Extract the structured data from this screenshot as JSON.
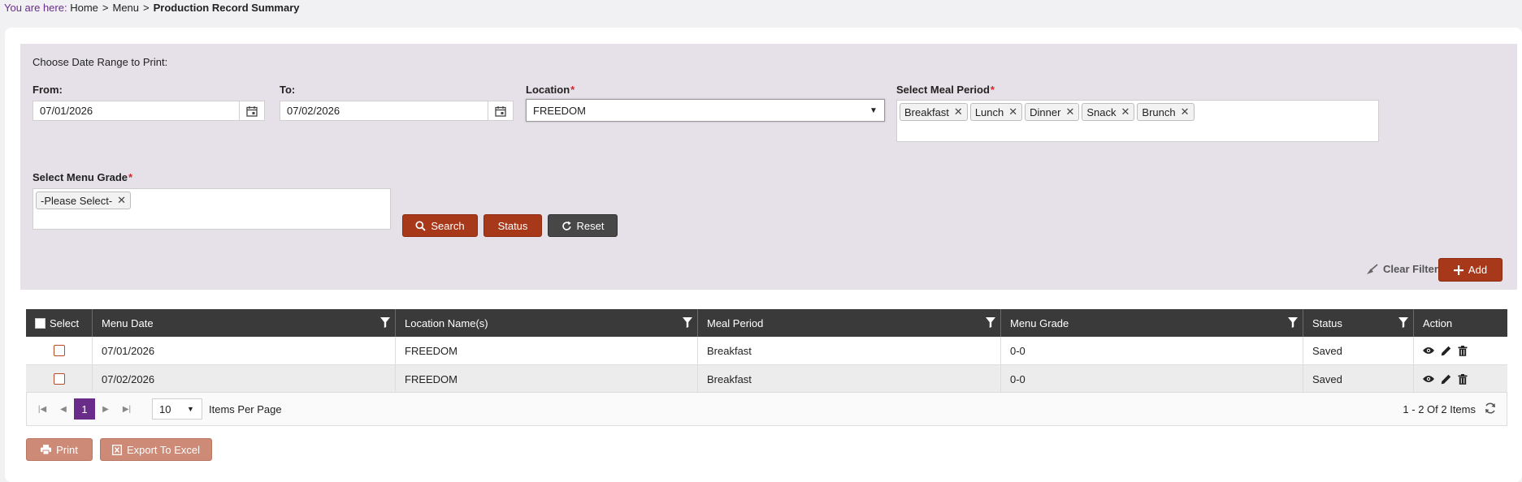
{
  "breadcrumb": {
    "prefix": "You are here:",
    "home": "Home",
    "menu": "Menu",
    "current": "Production Record Summary",
    "separator": ">"
  },
  "filters": {
    "heading": "Choose Date Range to Print:",
    "from": {
      "label": "From:",
      "value": "07/01/2026"
    },
    "to": {
      "label": "To:",
      "value": "07/02/2026"
    },
    "location": {
      "label": "Location",
      "required": "*",
      "value": "FREEDOM"
    },
    "meal_period": {
      "label": "Select Meal Period",
      "required": "*",
      "chips": [
        "Breakfast",
        "Lunch",
        "Dinner",
        "Snack",
        "Brunch"
      ]
    },
    "menu_grade": {
      "label": "Select Menu Grade",
      "required": "*",
      "chips": [
        "-Please Select-"
      ]
    },
    "buttons": {
      "search": "Search",
      "status": "Status",
      "reset": "Reset"
    },
    "clear_filter": "Clear Filter",
    "add": "Add"
  },
  "grid": {
    "columns": {
      "select": "Select",
      "menu_date": "Menu Date",
      "location": "Location Name(s)",
      "meal_period": "Meal Period",
      "menu_grade": "Menu Grade",
      "status": "Status",
      "action": "Action"
    },
    "rows": [
      {
        "menu_date": "07/01/2026",
        "location": "FREEDOM",
        "meal_period": "Breakfast",
        "menu_grade": "0-0",
        "status": "Saved"
      },
      {
        "menu_date": "07/02/2026",
        "location": "FREEDOM",
        "meal_period": "Breakfast",
        "menu_grade": "0-0",
        "status": "Saved"
      }
    ]
  },
  "pager": {
    "current_page": "1",
    "page_size": "10",
    "items_per_page_label": "Items Per Page",
    "info": "1 - 2 Of 2 Items"
  },
  "footer": {
    "print": "Print",
    "export": "Export To Excel"
  },
  "colors": {
    "primary": "#a8381a",
    "accent_purple": "#6a2c8a",
    "header_dark": "#3a3a3a",
    "panel": "#e6e1e8"
  }
}
